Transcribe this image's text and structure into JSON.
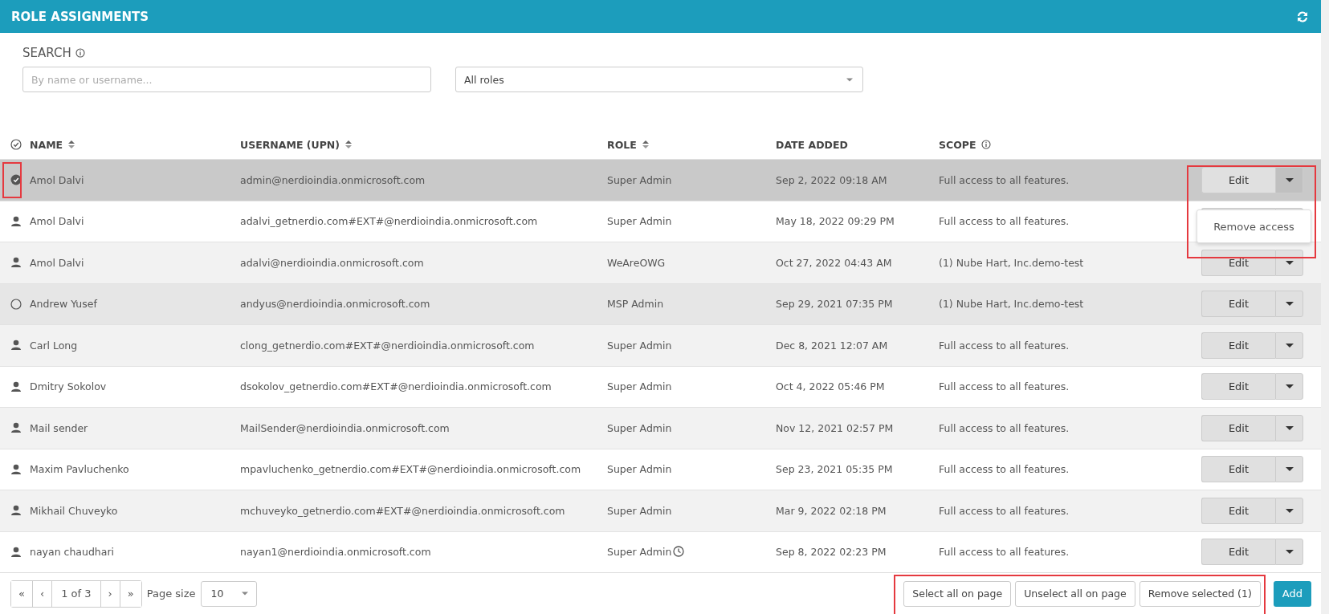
{
  "header": {
    "title": "ROLE ASSIGNMENTS"
  },
  "search": {
    "label": "SEARCH",
    "placeholder": "By name or username...",
    "role_filter": "All roles"
  },
  "table": {
    "columns": [
      {
        "label": "NAME",
        "sortable": true,
        "info": false
      },
      {
        "label": "USERNAME (UPN)",
        "sortable": true,
        "info": false
      },
      {
        "label": "ROLE",
        "sortable": true,
        "info": false
      },
      {
        "label": "DATE ADDED",
        "sortable": false,
        "info": false
      },
      {
        "label": "SCOPE",
        "sortable": false,
        "info": true
      }
    ],
    "rows": [
      {
        "name": "Amol Dalvi",
        "username": "admin@nerdioindia.onmicrosoft.com",
        "role": "Super Admin",
        "clock": false,
        "date": "Sep 2, 2022 09:18 AM",
        "scope": "Full access to all features.",
        "action": "Edit",
        "selected": true,
        "hovered": false,
        "annotated": true,
        "menu": {
          "items": [
            "Remove access"
          ],
          "annotated": true
        }
      },
      {
        "name": "Amol Dalvi",
        "username": "adalvi_getnerdio.com#EXT#@nerdioindia.onmicrosoft.com",
        "role": "Super Admin",
        "clock": false,
        "date": "May 18, 2022 09:29 PM",
        "scope": "Full access to all features.",
        "selected": false,
        "hovered": false,
        "annotated": false
      },
      {
        "name": "Amol Dalvi",
        "username": "adalvi@nerdioindia.onmicrosoft.com",
        "role": "WeAreOWG",
        "clock": false,
        "date": "Oct 27, 2022 04:43 AM",
        "scope": "(1) Nube Hart, Inc.demo-test",
        "action": "Edit",
        "selected": false,
        "hovered": false,
        "annotated": false
      },
      {
        "name": "Andrew Yusef",
        "username": "andyus@nerdioindia.onmicrosoft.com",
        "role": "MSP Admin",
        "clock": false,
        "date": "Sep 29, 2021 07:35 PM",
        "scope": "(1) Nube Hart, Inc.demo-test",
        "action": "Edit",
        "selected": false,
        "hovered": true,
        "annotated": false
      },
      {
        "name": "Carl Long",
        "username": "clong_getnerdio.com#EXT#@nerdioindia.onmicrosoft.com",
        "role": "Super Admin",
        "clock": false,
        "date": "Dec 8, 2021 12:07 AM",
        "scope": "Full access to all features.",
        "action": "Edit",
        "selected": false,
        "hovered": false,
        "annotated": false
      },
      {
        "name": "Dmitry Sokolov",
        "username": "dsokolov_getnerdio.com#EXT#@nerdioindia.onmicrosoft.com",
        "role": "Super Admin",
        "clock": false,
        "date": "Oct 4, 2022 05:46 PM",
        "scope": "Full access to all features.",
        "action": "Edit",
        "selected": false,
        "hovered": false,
        "annotated": false
      },
      {
        "name": "Mail sender",
        "username": "MailSender@nerdioindia.onmicrosoft.com",
        "role": "Super Admin",
        "clock": false,
        "date": "Nov 12, 2021 02:57 PM",
        "scope": "Full access to all features.",
        "action": "Edit",
        "selected": false,
        "hovered": false,
        "annotated": false
      },
      {
        "name": "Maxim Pavluchenko",
        "username": "mpavluchenko_getnerdio.com#EXT#@nerdioindia.onmicrosoft.com",
        "role": "Super Admin",
        "clock": false,
        "date": "Sep 23, 2021 05:35 PM",
        "scope": "Full access to all features.",
        "action": "Edit",
        "selected": false,
        "hovered": false,
        "annotated": false
      },
      {
        "name": "Mikhail Chuveyko",
        "username": "mchuveyko_getnerdio.com#EXT#@nerdioindia.onmicrosoft.com",
        "role": "Super Admin",
        "clock": false,
        "date": "Mar 9, 2022 02:18 PM",
        "scope": "Full access to all features.",
        "action": "Edit",
        "selected": false,
        "hovered": false,
        "annotated": false
      },
      {
        "name": "nayan chaudhari",
        "username": "nayan1@nerdioindia.onmicrosoft.com",
        "role": "Super Admin",
        "clock": true,
        "date": "Sep 8, 2022 02:23 PM",
        "scope": "Full access to all features.",
        "action": "Edit",
        "selected": false,
        "hovered": false,
        "annotated": false
      }
    ]
  },
  "pager": {
    "first": "«",
    "prev": "‹",
    "page": "1 of 3",
    "next": "›",
    "last": "»",
    "page_size_label": "Page size",
    "page_size": "10"
  },
  "bulk_actions": {
    "annotated": true,
    "buttons": [
      "Select all on page",
      "Unselect all on page",
      "Remove selected (1)"
    ]
  },
  "add_button": "Add"
}
